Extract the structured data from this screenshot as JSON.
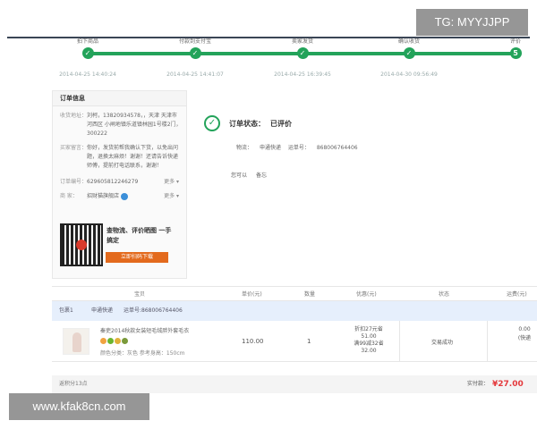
{
  "watermarks": {
    "top": "TG: MYYJJPP",
    "bottom": "www.kfak8cn.com"
  },
  "progress": {
    "steps": [
      {
        "label": "拍下商品",
        "marker": "✓",
        "time": "2014-04-25 14:40:24"
      },
      {
        "label": "付款到支付宝",
        "marker": "✓",
        "time": "2014-04-25 14:41:07"
      },
      {
        "label": "卖家发货",
        "marker": "✓",
        "time": "2014-04-25 16:39:45"
      },
      {
        "label": "确认收货",
        "marker": "✓",
        "time": "2014-04-30 09:56:49"
      },
      {
        "label": "评价",
        "marker": "5",
        "time": ""
      }
    ]
  },
  "order_info": {
    "title": "订单信息",
    "address_label": "收货地址：",
    "address": "刘柯，13820934578，，天津 天津市 河西区 小闸地镇乐道镇林园1号楼2门，300222",
    "message_label": "买家留言：",
    "message": "你好，发货前帮我确认下货，以免出问题，退换太麻烦！谢谢！还请告诉快递师傅，提前打电话联系，谢谢！",
    "order_no_label": "订单编号：",
    "order_no": "629605812246279",
    "more1": "更多 ▾",
    "seller_label": "商  家：",
    "seller": "招财猫旗舰店",
    "more2": "更多 ▾",
    "qr_text": "查物流、评价晒图 一手搞定",
    "qr_button": "立即扫码下载"
  },
  "status": {
    "icon": "✓",
    "label": "订单状态：",
    "value": "已评价",
    "logistics_label": "物流：",
    "courier": "申通快递",
    "tracking_label": "运单号：",
    "tracking_no": "868006764406",
    "ask_label": "您可以",
    "ask_action": "备忘"
  },
  "table": {
    "headers": {
      "product": "宝贝",
      "price": "单价(元)",
      "qty": "数量",
      "discount": "优惠(元)",
      "state": "状态",
      "shipping": "运费(元)"
    },
    "group": {
      "index": "包裹1",
      "courier": "申通快递",
      "tracking_label": "运单号:",
      "tracking_no": "868006764406"
    },
    "row": {
      "title": "秦吏2014秋款女装短毛绒胖外套毛衣",
      "spec": "颜色分类：灰色  参考身高：150cm",
      "price": "110.00",
      "qty": "1",
      "discount_line1": "折扣27元省",
      "discount_line2": "51.00",
      "discount_line3": "满99减32省",
      "discount_line4": "32.00",
      "state": "交易成功",
      "shipping": "0.00",
      "shipping_note": "(快递"
    },
    "footer_left": "返积分13点",
    "paid_label": "实付款：",
    "paid_value": "¥27.00"
  },
  "colors": {
    "accent_green": "#23a35a",
    "price_red": "#e4393c",
    "button_orange": "#e36a1d"
  }
}
